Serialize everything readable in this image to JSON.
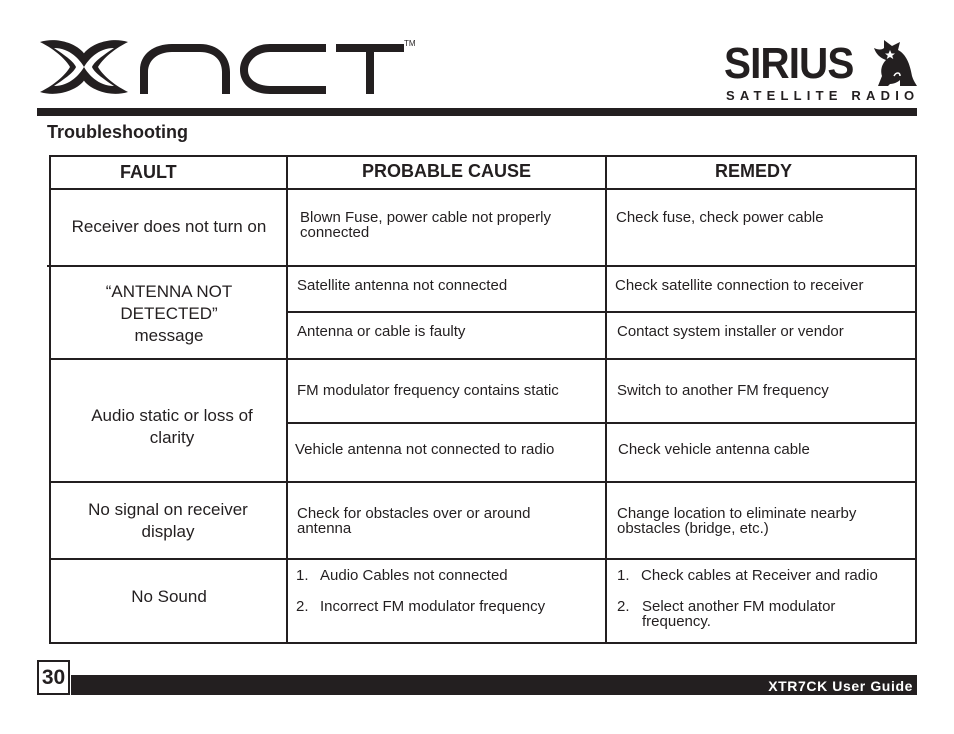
{
  "header": {
    "left_logo": {
      "text": "XACT",
      "trademark": "TM",
      "icon": "xact-logo"
    },
    "right_logo": {
      "word": "SIRIUS",
      "tagline": "SATELLITE RADIO",
      "icon": "sirius-dog-logo"
    }
  },
  "section_title": "Troubleshooting",
  "table": {
    "columns": [
      "FAULT",
      "PROBABLE CAUSE",
      "REMEDY"
    ],
    "rows": [
      {
        "fault": "Receiver does not turn on",
        "entries": [
          {
            "cause": "Blown Fuse, power cable not properly connected",
            "remedy": "Check fuse, check power cable"
          }
        ]
      },
      {
        "fault": "“ANTENNA NOT DETECTED” message",
        "entries": [
          {
            "cause": "Satellite antenna not connected",
            "remedy": "Check satellite connection to receiver"
          },
          {
            "cause": "Antenna or cable is faulty",
            "remedy": "Contact system installer or vendor"
          }
        ]
      },
      {
        "fault": "Audio static or loss of clarity",
        "entries": [
          {
            "cause": "FM modulator frequency contains static",
            "remedy": "Switch to another FM frequency"
          },
          {
            "cause": "Vehicle antenna not connected to radio",
            "remedy": "Check vehicle antenna cable"
          }
        ]
      },
      {
        "fault": "No signal on receiver display",
        "entries": [
          {
            "cause": "Check for obstacles over or around antenna",
            "remedy": "Change location to eliminate nearby obstacles (bridge, etc.)"
          }
        ]
      },
      {
        "fault": "No Sound",
        "causes_list": [
          {
            "num": "1.",
            "text": "Audio Cables not connected"
          },
          {
            "num": "2.",
            "text": "Incorrect FM modulator frequency"
          }
        ],
        "remedies_list": [
          {
            "num": "1.",
            "text": "Check cables at Receiver and radio"
          },
          {
            "num": "2.",
            "text": "Select another FM modulator frequency."
          }
        ]
      }
    ]
  },
  "footer": {
    "page_number": "30",
    "guide_title": "XTR7CK User Guide"
  },
  "colors": {
    "ink": "#231f20",
    "background": "#ffffff"
  }
}
